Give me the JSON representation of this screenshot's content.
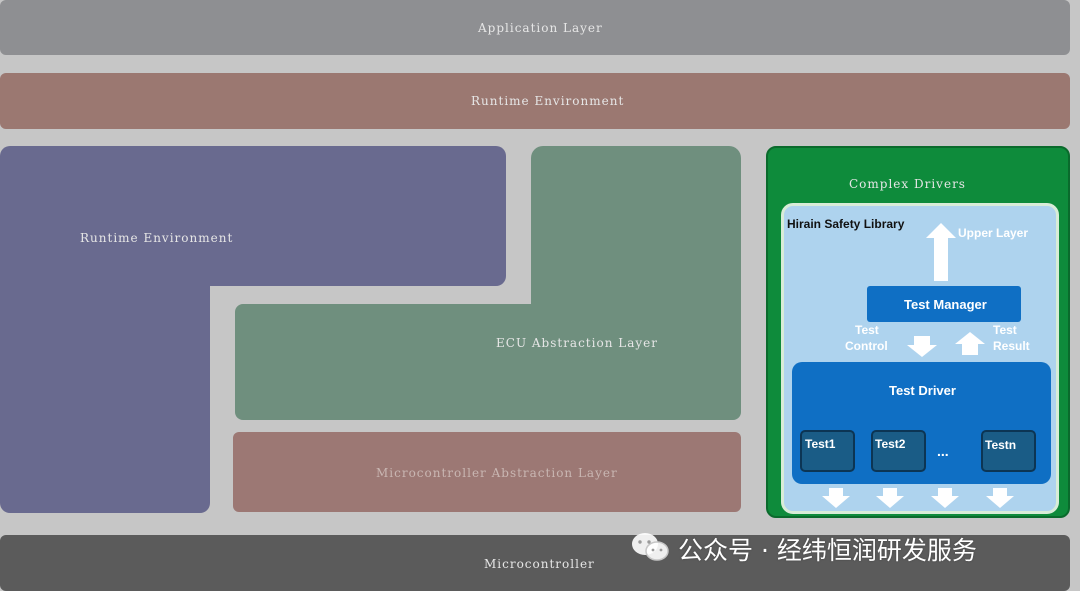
{
  "layers": {
    "application": "Application Layer",
    "rte_top": "Runtime Environment",
    "services": "Runtime Environment",
    "ecu_abstraction": "ECU Abstraction Layer",
    "mcal": "Microcontroller Abstraction Layer",
    "microcontroller": "Microcontroller"
  },
  "complex_drivers": {
    "title": "Complex Drivers",
    "library": {
      "title": "Hirain  Safety Library",
      "upper_layer": "Upper Layer",
      "test_manager": "Test Manager",
      "test_control": [
        "Test",
        "Control"
      ],
      "test_result": [
        "Test",
        "Result"
      ],
      "test_driver": "Test Driver",
      "tests": [
        "Test1",
        "Test2",
        "Testn"
      ],
      "ellipsis": "..."
    }
  },
  "watermark": {
    "icon": "wechat-icon",
    "text": "公众号 · 经纬恒润研发服务"
  },
  "colors": {
    "application": "#8e8f92",
    "rte": "#9b7871",
    "services": "#696a8f",
    "ecu": "#6f8f7e",
    "microcontroller": "#5b5b5b",
    "complex_drivers": "#0e8b3b",
    "safety_library": "#aed3ee",
    "test_blocks": "#0f6fc4"
  }
}
